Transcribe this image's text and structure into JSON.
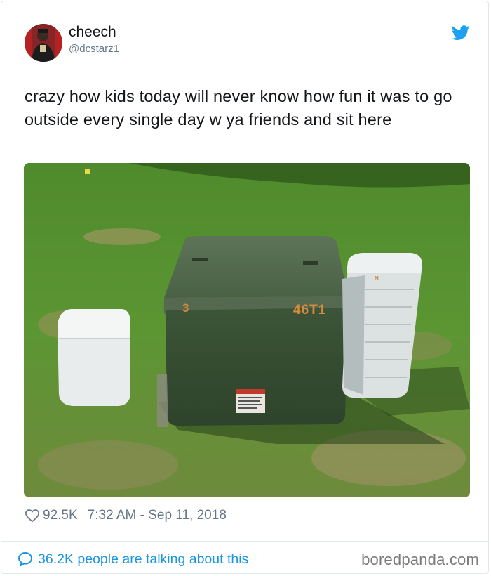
{
  "user": {
    "display_name": "cheech",
    "handle": "@dcstarz1"
  },
  "tweet": {
    "text": "crazy how kids today will never know how fun it was to go outside every single day w ya friends and sit here"
  },
  "photo": {
    "label_3": "3",
    "label_46t1": "46T1",
    "label_n": "N"
  },
  "meta": {
    "likes": "92.5K",
    "timestamp": "7:32 AM - Sep 11, 2018"
  },
  "footer": {
    "talking": "36.2K people are talking about this",
    "brand": "boredpanda.com"
  },
  "colors": {
    "twitter_blue": "#1da1f2",
    "link_blue": "#1b95e0",
    "muted": "#657786"
  },
  "icons": [
    "twitter-bird-icon",
    "heart-icon",
    "speech-bubble-icon"
  ]
}
